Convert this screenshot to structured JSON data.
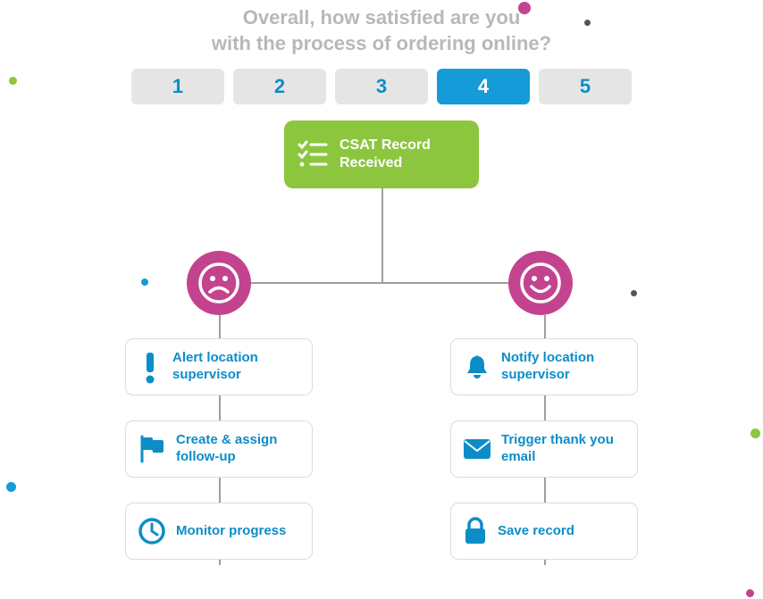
{
  "question_line1": "Overall, how satisfied are you",
  "question_line2": "with the process of ordering online?",
  "ratings": [
    "1",
    "2",
    "3",
    "4",
    "5"
  ],
  "selected_rating_index": 3,
  "root": {
    "label_line1": "CSAT Record",
    "label_line2": "Received"
  },
  "left_branch": {
    "face": "sad",
    "actions": [
      {
        "icon": "exclaim",
        "label": "Alert location supervisor"
      },
      {
        "icon": "flag",
        "label": "Create & assign follow-up"
      },
      {
        "icon": "clock",
        "label": "Monitor progress"
      }
    ]
  },
  "right_branch": {
    "face": "smile",
    "actions": [
      {
        "icon": "bell",
        "label": "Notify location supervisor"
      },
      {
        "icon": "envelope",
        "label": "Trigger thank you email"
      },
      {
        "icon": "lock",
        "label": "Save record"
      }
    ]
  },
  "colors": {
    "accent_blue": "#0d8dc8",
    "selected_blue": "#159bd7",
    "green": "#8cc63f",
    "magenta": "#c4438f",
    "gray_btn": "#e5e5e5",
    "gray_text": "#b8b8b8",
    "border": "#dcdcdc"
  }
}
